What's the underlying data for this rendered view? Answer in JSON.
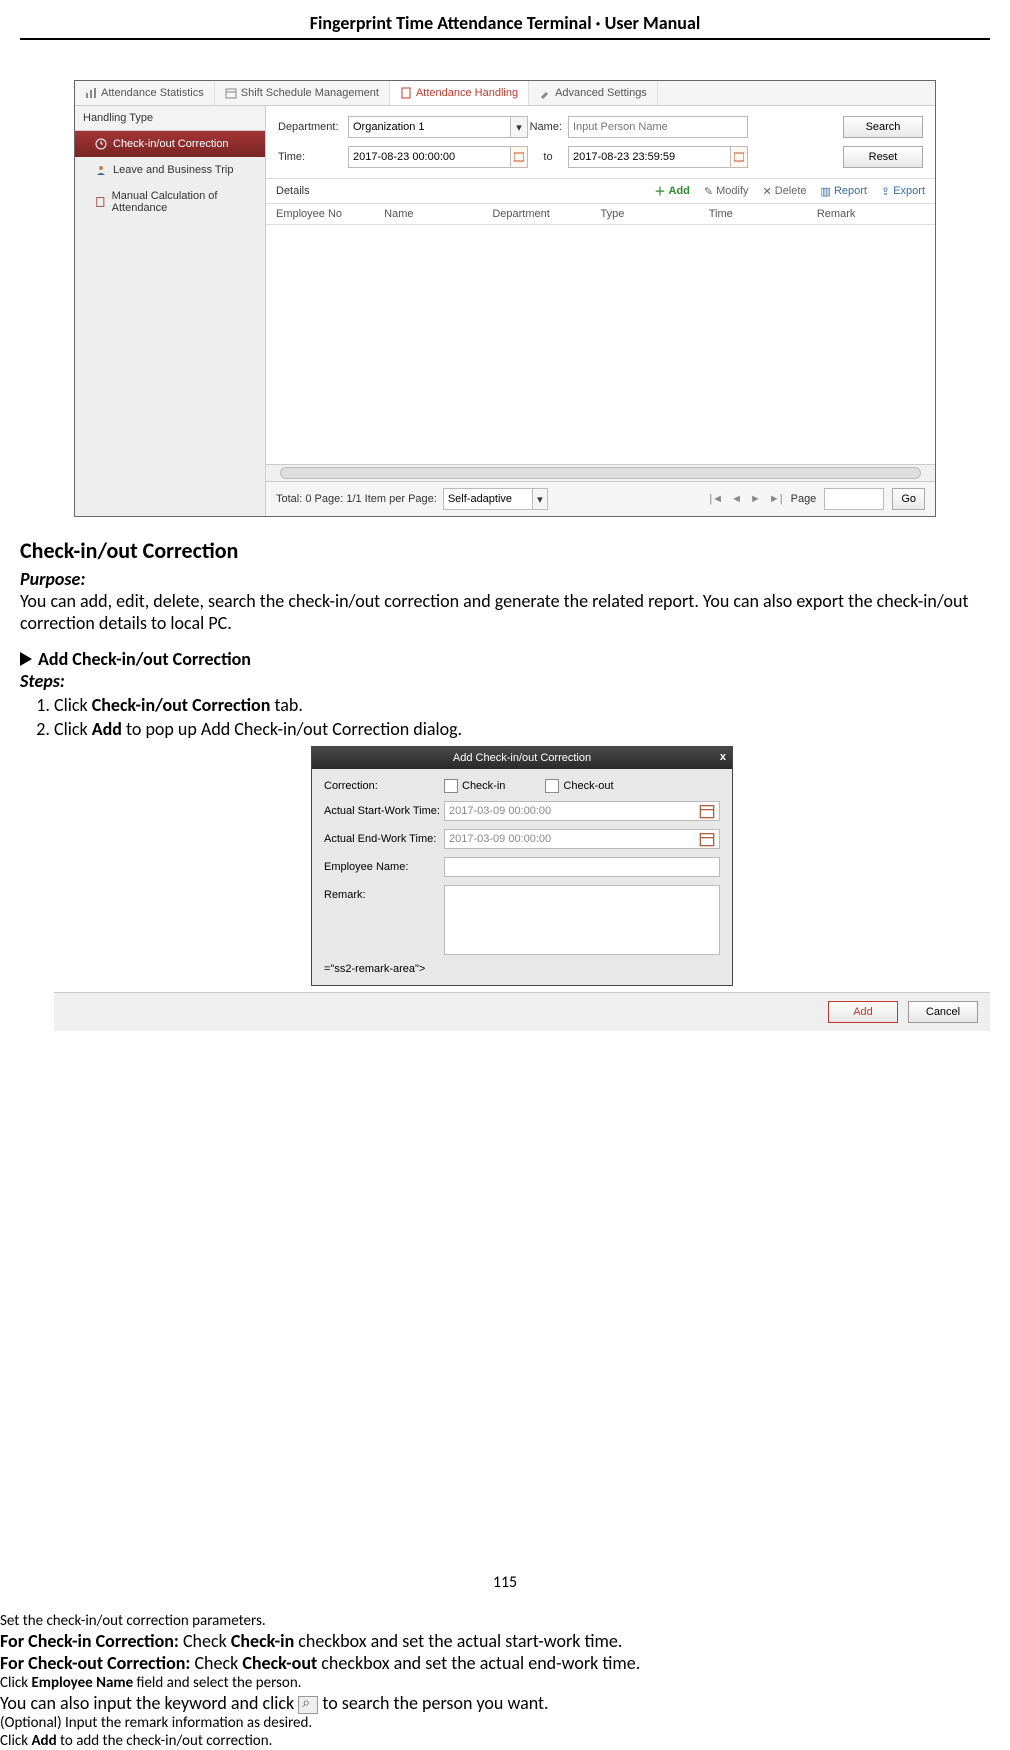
{
  "doc": {
    "header": "Fingerprint Time Attendance Terminal · User Manual",
    "page_number": "115",
    "h2": "Check-in/out Correction",
    "purpose_label": "Purpose:",
    "purpose_text": "You can add, edit, delete, search the check-in/out correction and generate the related report. You can also export the check-in/out correction details to local PC.",
    "sub_h": "Add Check-in/out Correction",
    "steps_label": "Steps:",
    "step1_a": "Click ",
    "step1_b": "Check-in/out Correction",
    "step1_c": " tab.",
    "step2_a": "Click ",
    "step2_b": "Add",
    "step2_c": " to pop up Add Check-in/out Correction dialog.",
    "step3": "Set the check-in/out correction parameters.",
    "step3_ci_a": "For Check-in Correction: ",
    "step3_ci_b": "Check ",
    "step3_ci_c": "Check-in",
    "step3_ci_d": " checkbox and set the actual start-work time.",
    "step3_co_a": "For Check-out Correction: ",
    "step3_co_b": "Check ",
    "step3_co_c": "Check-out",
    "step3_co_d": " checkbox and set the actual end-work time.",
    "step4_a": "Click ",
    "step4_b": "Employee Name",
    "step4_c": " field and select the person.",
    "step4_note_a": "You can also input the keyword and click ",
    "step4_note_b": " to search the person you want.",
    "step5": "(Optional) Input the remark information as desired.",
    "step6_a": "Click ",
    "step6_b": "Add",
    "step6_c": " to add the check-in/out correction."
  },
  "ss1": {
    "tabs": {
      "t1": "Attendance Statistics",
      "t2": "Shift Schedule Management",
      "t3": "Attendance Handling",
      "t4": "Advanced Settings"
    },
    "side": {
      "title": "Handling Type",
      "i1": "Check-in/out Correction",
      "i2": "Leave and Business Trip",
      "i3": "Manual Calculation of Attendance"
    },
    "filter": {
      "dept_label": "Department:",
      "dept_value": "Organization 1",
      "name_label": "Name:",
      "name_placeholder": "Input Person Name",
      "time_label": "Time:",
      "time_from": "2017-08-23 00:00:00",
      "time_to_label": "to",
      "time_to": "2017-08-23 23:59:59",
      "search": "Search",
      "reset": "Reset"
    },
    "details_label": "Details",
    "toolbar": {
      "add": "Add",
      "modify": "Modify",
      "delete": "Delete",
      "report": "Report",
      "export": "Export"
    },
    "cols": {
      "c1": "Employee No",
      "c2": "Name",
      "c3": "Department",
      "c4": "Type",
      "c5": "Time",
      "c6": "Remark"
    },
    "footer": {
      "summary": "Total: 0   Page: 1/1   Item per Page:",
      "perpage": "Self-adaptive",
      "page_label": "Page",
      "go": "Go"
    }
  },
  "ss2": {
    "title": "Add Check-in/out Correction",
    "labels": {
      "correction": "Correction:",
      "checkin": "Check-in",
      "checkout": "Check-out",
      "start": "Actual Start-Work Time:",
      "end": "Actual End-Work Time:",
      "emp": "Employee Name:",
      "remark": "Remark:"
    },
    "values": {
      "start": "2017-03-09 00:00:00",
      "end": "2017-03-09 00:00:00"
    },
    "buttons": {
      "add": "Add",
      "cancel": "Cancel"
    }
  }
}
